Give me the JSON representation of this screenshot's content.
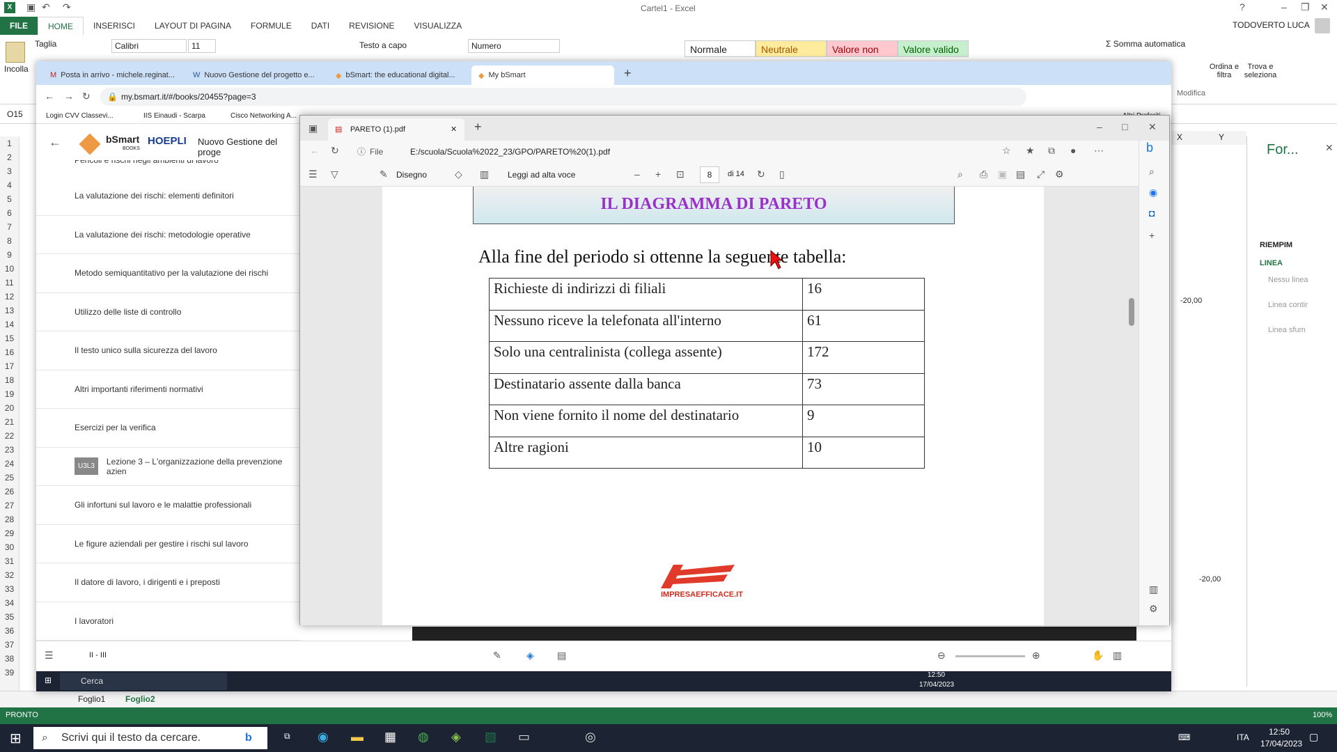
{
  "excel": {
    "title": "Cartel1 - Excel",
    "user": "TODOVERTO LUCA",
    "ribbon_tabs": [
      "FILE",
      "HOME",
      "INSERISCI",
      "LAYOUT DI PAGINA",
      "FORMULE",
      "DATI",
      "REVISIONE",
      "VISUALIZZA"
    ],
    "paste_label": "Incolla",
    "cut_label": "Taglia",
    "font_name": "Calibri",
    "font_size": "11",
    "wrap_text": "Testo a capo",
    "number_format": "Numero",
    "styles": [
      "Normale",
      "Neutrale",
      "Valore non v...",
      "Valore valido"
    ],
    "autosum": "Somma automatica",
    "sort_filter": "Ordina e filtra",
    "find_select": "Trova e seleziona",
    "modify": "Modifica",
    "cell_ref": "O15",
    "row_numbers": [
      "1",
      "2",
      "3",
      "4",
      "5",
      "6",
      "7",
      "8",
      "9",
      "10",
      "11",
      "12",
      "13",
      "14",
      "15",
      "16",
      "17",
      "18",
      "19",
      "20",
      "21",
      "22",
      "23",
      "24",
      "25",
      "26",
      "27",
      "28",
      "29",
      "30",
      "31",
      "32",
      "33",
      "34",
      "35",
      "36",
      "37",
      "38",
      "39"
    ],
    "col_x": "X",
    "col_y": "Y",
    "value_a": "-20,00",
    "value_b": "-20,00",
    "pane_title": "For...",
    "fill_label": "RIEMPIM",
    "line_label": "LINEA",
    "line_opts": [
      "Nessu linea",
      "Linea contir",
      "Linea sfum"
    ],
    "sheets": [
      "Foglio1",
      "Foglio2"
    ],
    "status": "PRONTO",
    "zoom": "100%"
  },
  "chrome": {
    "tabs": [
      "Posta in arrivo - michele.reginat...",
      "Nuovo Gestione del progetto e...",
      "bSmart: the educational digital...",
      "My bSmart"
    ],
    "url": "my.bsmart.it/#/books/20455?page=3",
    "bookmarks": [
      "Login CVV Classevi...",
      "IIS Einaudi - Scarpa",
      "Cisco Networking A...",
      "Altri Preferiti"
    ]
  },
  "bsmart": {
    "brand": "bSmart",
    "brand_sub": "BOOKS",
    "publisher": "HOEPLI",
    "book_title": "Nuovo Gestione del proge",
    "partial_item": "Pericoli e rischi negli ambienti di lavoro",
    "items": [
      "La valutazione dei rischi: elementi definitori",
      "La valutazione dei rischi: metodologie operative",
      "Metodo semiquantitativo per la valutazione dei rischi",
      "Utilizzo delle liste di controllo",
      "Il testo unico sulla sicurezza del lavoro",
      "Altri importanti riferimenti normativi",
      "Esercizi per la verifica",
      "Lezione 3 – L'organizzazione della prevenzione azien",
      "Gli infortuni sul lavoro e le malattie professionali",
      "Le figure aziendali per gestire i rischi sul lavoro",
      "Il datore di lavoro, i dirigenti e i preposti",
      "I lavoratori"
    ],
    "lesson_badge": "U3L3",
    "page_indicator": "II - III",
    "search_placeholder": "Cerca",
    "time": "12:50",
    "date": "17/04/2023"
  },
  "edge": {
    "tab_title": "PARETO (1).pdf",
    "file_label": "File",
    "url": "E:/scuola/Scuola%2022_23/GPO/PARETO%20(1).pdf",
    "draw_label": "Disegno",
    "read_aloud": "Leggi ad alta voce",
    "page_current": "8",
    "page_total": "di 14"
  },
  "pdf": {
    "title": "IL DIAGRAMMA DI PARETO",
    "sentence": "Alla fine del periodo si ottenne la seguente tabella:",
    "rows": [
      {
        "label": "Richieste di indirizzi di filiali",
        "value": "16"
      },
      {
        "label": "Nessuno riceve la telefonata all'interno",
        "value": "61"
      },
      {
        "label": "Solo una centralinista (collega assente)",
        "value": "172"
      },
      {
        "label": "Destinatario assente dalla banca",
        "value": "73"
      },
      {
        "label": "Non viene fornito il nome del destinatario",
        "value": "9"
      },
      {
        "label": "Altre ragioni",
        "value": "10"
      }
    ],
    "logo_text": "IMPRESAEFFICACE.IT"
  },
  "taskbar": {
    "search_placeholder": "Scrivi qui il testo da cercare.",
    "lang": "ITA",
    "time": "12:50",
    "date": "17/04/2023"
  }
}
